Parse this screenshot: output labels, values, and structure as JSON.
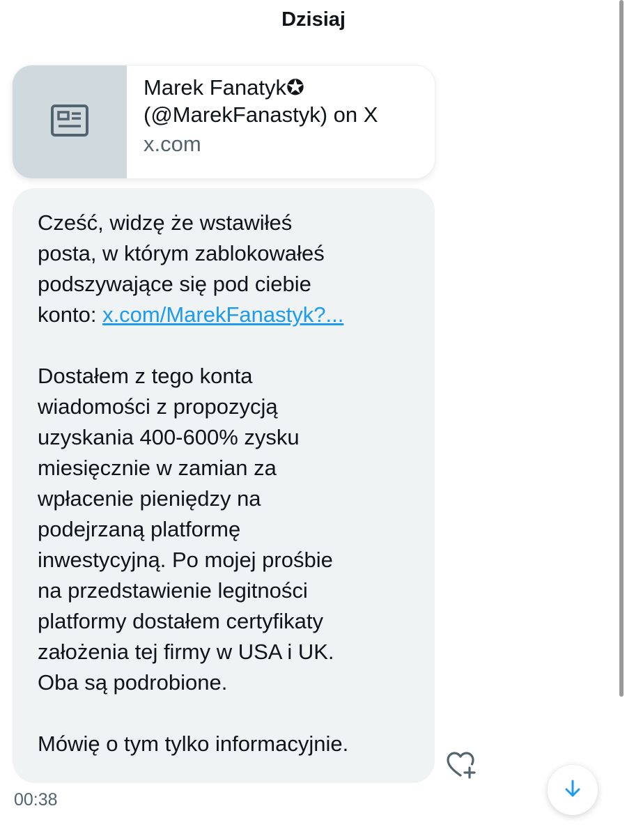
{
  "header": {
    "date_label": "Dzisiaj"
  },
  "link_card": {
    "title": "Marek Fanatyk✪\n(@MarekFanastyk) on X",
    "domain": "x.com",
    "thumbnail_icon": "newspaper-icon"
  },
  "message": {
    "paragraph1_text": "Cześć, widzę że wstawiłeś\nposta, w którym zablokowałeś\npodszywające się pod ciebie\nkonto: ",
    "paragraph1_link": "x.com/MarekFanastyk?...",
    "paragraph2": "Dostałem z tego konta\nwiadomości z propozycją\nuzyskania 400-600% zysku\nmiesięcznie w zamian za\nwpłacenie pieniędzy na\npodejrzaną platformę\ninwestycyjną. Po mojej prośbie\nna przedstawienie legitności\nplatformy dostałem certyfikaty\nzałożenia tej firmy w USA i UK.\nOba są podrobione.",
    "paragraph3": "Mówię o tym tylko informacyjnie.",
    "timestamp": "00:38",
    "bubble_color": "#eff3f4",
    "link_color": "#1d9bf0"
  },
  "actions": {
    "react_icon": "heart-plus-icon",
    "scroll_down_icon": "arrow-down-icon",
    "accent_color": "#1d9bf0"
  }
}
